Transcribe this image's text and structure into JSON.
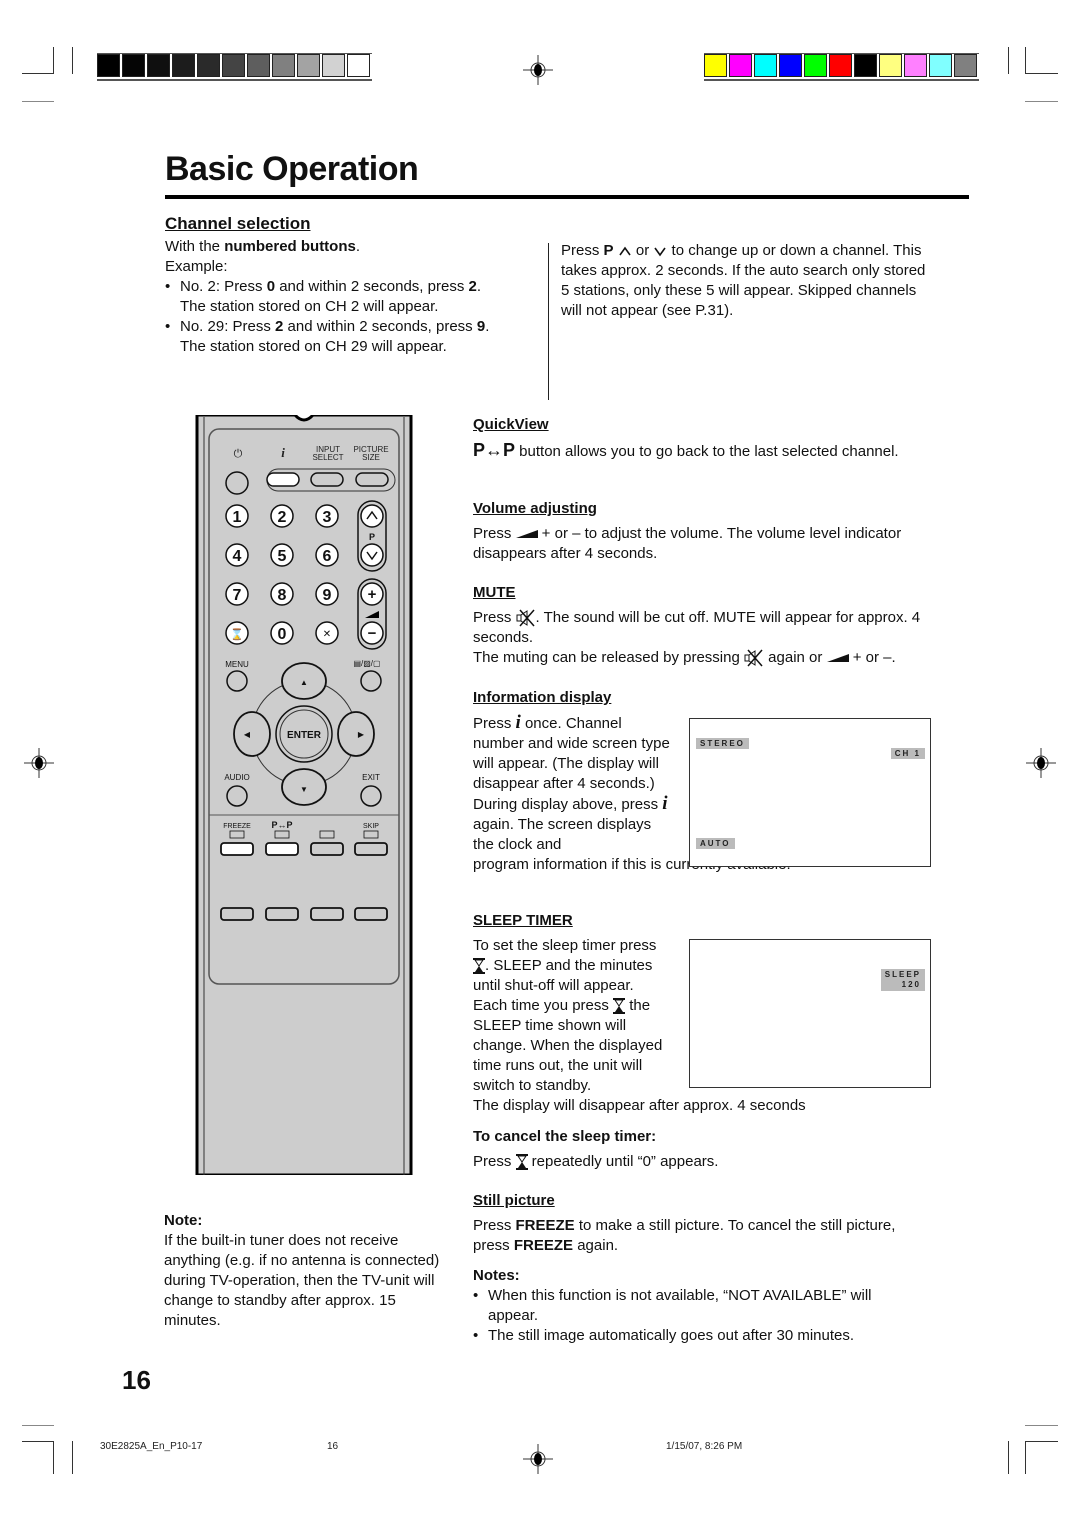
{
  "header": {
    "grayscale_swatches": [
      "#000000",
      "#050505",
      "#0f0f0f",
      "#1c1c1c",
      "#2a2a2a",
      "#444444",
      "#5e5e5e",
      "#808080",
      "#a3a3a3",
      "#d2d2d2",
      "#ffffff"
    ],
    "color_swatches": [
      "#ffff00",
      "#ff00ff",
      "#00ffff",
      "#0000ff",
      "#00ff00",
      "#ff0000",
      "#000000",
      "#ffff80",
      "#ff80ff",
      "#80ffff",
      "#808080"
    ]
  },
  "page": {
    "title": "Basic Operation",
    "page_number": "16"
  },
  "channel_selection": {
    "heading": "Channel selection",
    "intro_prefix": "With the ",
    "intro_bold": "numbered buttons",
    "intro_suffix": ".",
    "example_label": "Example:",
    "bullets": [
      {
        "a": "No. 2: Press ",
        "b1": "0",
        "c": " and within 2 seconds, press ",
        "b2": "2",
        "d": ".",
        "line2": "The station stored on CH 2 will appear."
      },
      {
        "a": "No. 29: Press ",
        "b1": "2",
        "c": " and within 2 seconds, press ",
        "b2": "9",
        "d": ".",
        "line2": "The station stored on CH 29 will appear."
      }
    ],
    "right_text_prefix": "Press ",
    "right_text_bold": "P",
    "right_text_mid": " or ",
    "right_text_rest": " to change up or down a channel. This takes approx. 2 seconds. If the auto search only stored 5 stations, only these 5 will appear. Skipped channels will not appear (see P.31)."
  },
  "remote": {
    "top_labels": {
      "power": "⏻",
      "info": "i",
      "input_select": "INPUT\nSELECT",
      "picture_size": "PICTURE\nSIZE"
    },
    "digits": [
      "1",
      "2",
      "3",
      "4",
      "5",
      "6",
      "7",
      "8",
      "9",
      "0"
    ],
    "p_label": "P",
    "menu": "MENU",
    "enter": "ENTER",
    "audio": "AUDIO",
    "exit": "EXIT",
    "freeze": "FREEZE",
    "pp": "P↔P",
    "skip": "SKIP"
  },
  "quickview": {
    "heading": "QuickView",
    "bold": "P↔P",
    "text": " button allows you to go back to the last selected channel."
  },
  "volume": {
    "heading": "Volume adjusting",
    "t1": "Press ",
    "t2": " + or – to adjust the volume. The volume level indicator disappears after 4 seconds."
  },
  "mute": {
    "heading": "MUTE",
    "t1": "Press ",
    "t2": ". The sound will be cut off. MUTE will appear for approx. 4 seconds.",
    "t3": "The muting can be released by pressing ",
    "t4": " again or ",
    "t5": " + or –."
  },
  "info_display": {
    "heading": "Information display",
    "t1": "Press ",
    "t2": " once. Channel number and wide screen type will appear. (The display will disappear after 4 seconds.)",
    "t3": "During display above, press ",
    "t4": " again. The screen displays the clock and",
    "t5": "program information if this is currently available.",
    "osd": {
      "stereo": "STEREO",
      "channel": "CH 1",
      "mode": "AUTO"
    }
  },
  "sleep_timer": {
    "heading": "SLEEP TIMER",
    "t1": "To set the sleep timer press",
    "t2": ". SLEEP and the minutes until shut-off will appear.",
    "t3": "Each time you press ",
    "t4": " the SLEEP time shown will change. When the displayed time runs out, the unit will switch to standby.",
    "t5": "The display will disappear after approx. 4 seconds",
    "osd": {
      "label": "SLEEP",
      "minutes": "120"
    },
    "cancel_heading": "To cancel the sleep timer:",
    "cancel_t1": "Press ",
    "cancel_t2": " repeatedly until “0” appears."
  },
  "still_picture": {
    "heading": "Still picture",
    "t1": "Press ",
    "b1": "FREEZE",
    "t2": " to make a still picture. To cancel the still picture, press ",
    "b2": "FREEZE",
    "t3": " again.",
    "notes_heading": "Notes:",
    "notes": [
      "When this function is not available, “NOT AVAILABLE” will appear.",
      "The still image automatically goes out after 30 minutes."
    ]
  },
  "note": {
    "heading": "Note:",
    "text": "If the built-in tuner does not receive anything (e.g. if no antenna is connected) during TV-operation, then the TV-unit will change to standby after approx. 15 minutes."
  },
  "footer": {
    "file": "30E2825A_En_P10-17",
    "page": "16",
    "timestamp": "1/15/07, 8:26 PM"
  }
}
